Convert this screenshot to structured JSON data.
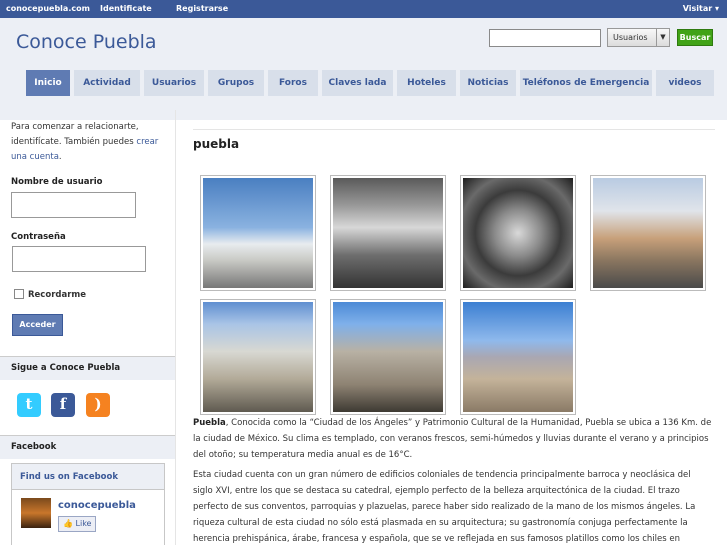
{
  "topbar": {
    "site": "conocepuebla.com",
    "identify": "Identificate",
    "register": "Registrarse",
    "visitor": "Visitar ▾"
  },
  "header": {
    "title": "Conoce Puebla",
    "search_value": "",
    "select_value": "Usuarios",
    "search_button": "Buscar"
  },
  "nav": {
    "tabs": [
      "Inicio",
      "Actividad",
      "Usuarios",
      "Grupos",
      "Foros",
      "Claves lada",
      "Hoteles",
      "Noticias",
      "Teléfonos de Emergencia",
      "videos"
    ],
    "active": "Inicio"
  },
  "sidebar": {
    "intro_text": "Para comenzar a relacionarte, identifícate. También puedes ",
    "intro_link": "crear una cuenta",
    "intro_end": ".",
    "username_label": "Nombre de usuario",
    "password_label": "Contraseña",
    "remember_label": "Recordarme",
    "login_button": "Acceder",
    "follow_title": "Sigue a Conoce Puebla",
    "social_icons": [
      "twitter-icon",
      "facebook-icon",
      "rss-icon"
    ],
    "facebook_title": "Facebook",
    "fb_box_title": "Find us on Facebook",
    "fb_page_name": "conocepuebla",
    "like_label": "Like"
  },
  "main": {
    "title": "puebla",
    "photos": [
      "puebla-photo-1",
      "puebla-photo-2",
      "puebla-photo-3",
      "puebla-photo-4",
      "puebla-photo-5",
      "puebla-photo-6",
      "puebla-photo-7"
    ],
    "para1_bold": "Puebla",
    "para1": ", Conocida como la “Ciudad de los Ángeles” y Patrimonio Cultural de la Humanidad, Puebla se ubica a 136 Km. de la ciudad de México. Su clima es templado, con veranos frescos, semi-húmedos y lluvias durante el verano y a principios del otoño; su temperatura media anual es de 16°C.",
    "para2": "Esta ciudad cuenta con un gran número de edificios coloniales de tendencia principalmente barroca y neoclásica del siglo XVI, entre los que se destaca su catedral, ejemplo perfecto de la belleza arquitectónica de la ciudad. El trazo perfecto de sus conventos, parroquias y plazuelas, parece haber sido realizado de la mano de los mismos ángeles. La riqueza cultural de esta ciudad no sólo está plasmada en su arquitectura; su gastronomía conjuga perfectamente la herencia prehispánica, árabe, francesa y española, que se ve reflejada en sus famosos platillos como los chiles en nogada y el mole poblano, que han"
  }
}
